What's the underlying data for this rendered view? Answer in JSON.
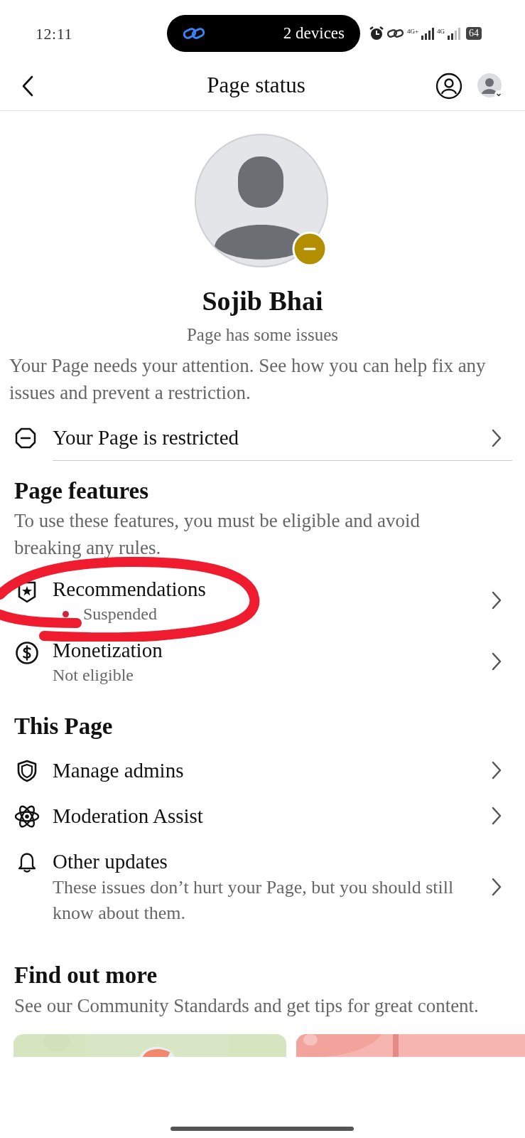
{
  "status_bar": {
    "time": "12:11",
    "pill_text": "2 devices",
    "network_1": "4G+",
    "network_2": "4G",
    "battery": "64"
  },
  "header": {
    "title": "Page status"
  },
  "profile": {
    "name": "Sojib Bhai",
    "status": "Page has some issues",
    "description": "Your Page needs your attention. See how you can help fix any issues and prevent a restriction."
  },
  "restriction_row": {
    "label": "Your Page is restricted"
  },
  "page_features": {
    "title": "Page features",
    "description": "To use these features, you must be eligible and avoid breaking any rules.",
    "items": [
      {
        "label": "Recommendations",
        "status": "Suspended",
        "flagged": true
      },
      {
        "label": "Monetization",
        "status": "Not eligible",
        "flagged": false
      }
    ]
  },
  "this_page": {
    "title": "This Page",
    "items": [
      {
        "label": "Manage admins"
      },
      {
        "label": "Moderation Assist"
      },
      {
        "label": "Other updates",
        "description": "These issues don’t hurt your Page, but you should still know about them."
      }
    ]
  },
  "find_out_more": {
    "title": "Find out more",
    "description": "See our Community Standards and get tips for great content."
  }
}
